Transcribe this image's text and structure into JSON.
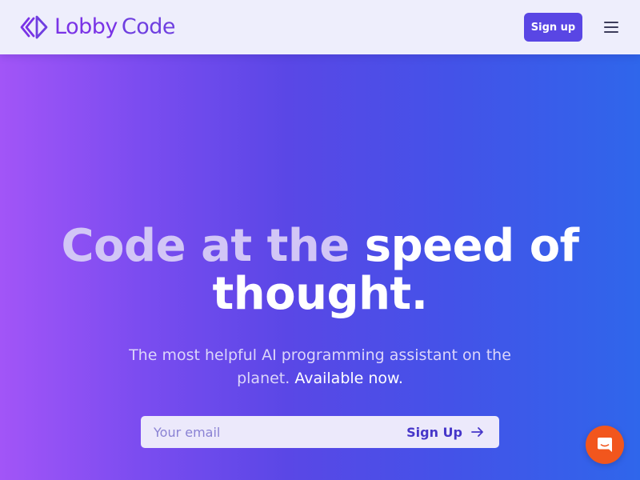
{
  "header": {
    "logo": {
      "word1": "Lobby",
      "word2": "Code",
      "icon": "lobbycode-logo-icon"
    },
    "signup_label": "Sign up",
    "menu_icon": "hamburger-menu-icon"
  },
  "hero": {
    "headline_dim": "Code at the",
    "headline_bright_1": "speed of",
    "headline_bright_2": "thought.",
    "subtext": "The most helpful AI programming assistant on the planet.",
    "subtext_highlight": "Available now."
  },
  "email_form": {
    "placeholder": "Your email",
    "value": "",
    "submit_label": "Sign Up",
    "submit_icon": "arrow-right-icon"
  },
  "chat": {
    "icon": "chat-bubble-icon"
  },
  "colors": {
    "brand_purple": "#7a33e6",
    "button_indigo": "#5946e4",
    "chat_orange": "#f2561d",
    "gradient_start": "#a255f7",
    "gradient_end": "#2f66eb"
  }
}
